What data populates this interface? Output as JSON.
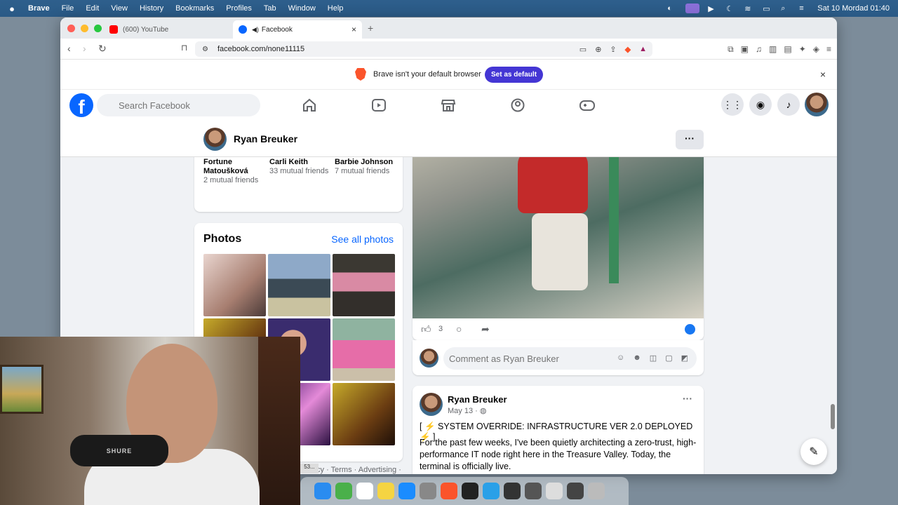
{
  "menubar": {
    "app": "Brave",
    "items": [
      "File",
      "Edit",
      "View",
      "History",
      "Bookmarks",
      "Profiles",
      "Tab",
      "Window",
      "Help"
    ],
    "clock": "Sat 10 Mordad  01:40"
  },
  "browser": {
    "tabs": [
      {
        "title": "(600) YouTube"
      },
      {
        "title": "Facebook"
      }
    ],
    "url": "facebook.com/none11115",
    "notice_text": "Brave isn't your default browser",
    "notice_button": "Set as default"
  },
  "facebook": {
    "search_placeholder": "Search Facebook",
    "profile_name": "Ryan Breuker",
    "more": "···",
    "friends": [
      {
        "name": "Fortune Matoušková",
        "mutual": "2 mutual friends"
      },
      {
        "name": "Carli Keith",
        "mutual": "33 mutual friends"
      },
      {
        "name": "Barbie Johnson",
        "mutual": "7 mutual friends"
      }
    ],
    "photos_title": "Photos",
    "photos_link": "See all photos",
    "footer_links": "Privacy · Terms · Advertising ·",
    "post1": {
      "like_count": "3",
      "comment_placeholder": "Comment as Ryan Breuker"
    },
    "post2": {
      "author": "Ryan Breuker",
      "date": "May 13 ·",
      "headline": "[ ⚡ SYSTEM OVERRIDE: INFRASTRUCTURE VER 2.0 DEPLOYED ⚡ ]",
      "body": "For the past few weeks, I've been quietly architecting a zero-trust, high-performance IT node right here in the Treasure Valley. Today, the terminal is officially live."
    }
  },
  "webcam": {
    "mic_brand": "SHURE"
  },
  "dock": {
    "tooltip": "53..."
  },
  "colors": {
    "facebook_blue": "#0866ff",
    "brave_orange": "#fb542b",
    "set_default_purple": "#4436d4"
  }
}
